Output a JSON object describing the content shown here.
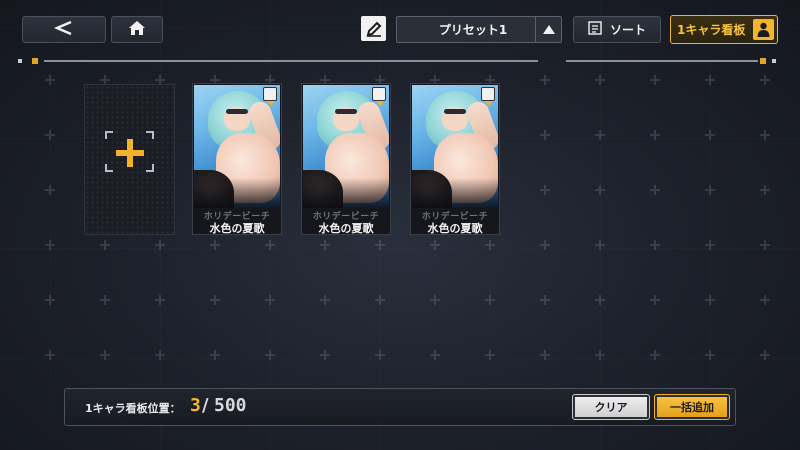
{
  "header": {
    "back_icon": "chevron-left-icon",
    "home_icon": "home-icon",
    "edit_icon": "pencil-icon",
    "preset_selected": "プリセット1",
    "preset_arrow_icon": "triangle-up-icon",
    "sort_label": "ソート",
    "sort_icon": "sort-list-icon",
    "board_toggle_label": "1キャラ看板",
    "board_toggle_icon": "person-icon",
    "accent_color": "#f2b22c"
  },
  "slots": {
    "add_icon": "plus-icon",
    "cards": [
      {
        "subtitle": "ホリデービーチ",
        "title": "水色の夏歌",
        "badge_icon": "download-badge-icon"
      },
      {
        "subtitle": "ホリデービーチ",
        "title": "水色の夏歌",
        "badge_icon": "download-badge-icon"
      },
      {
        "subtitle": "ホリデービーチ",
        "title": "水色の夏歌",
        "badge_icon": "download-badge-icon"
      }
    ]
  },
  "footer": {
    "position_label": "1キャラ看板位置：",
    "position_current": "3",
    "position_separator": "/",
    "position_max": "500",
    "clear_label": "クリア",
    "bulk_add_label": "一括追加"
  }
}
